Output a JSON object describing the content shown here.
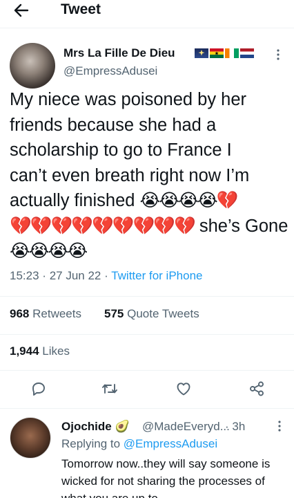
{
  "header": {
    "title": "Tweet",
    "back_icon": "arrow-left-icon"
  },
  "tweet": {
    "author_name": "Mrs La Fille De Dieu",
    "author_handle": "@EmpressAdusei",
    "name_flags": [
      "sparkle-night-flag",
      "ghana-flag",
      "ivory-coast-flag",
      "netherlands-flag"
    ],
    "text_line1": "My niece was poisoned by her",
    "text_line2": "friends because she had a",
    "text_line3": "scholarship to go to France I",
    "text_line4": "can’t even breath right now I’m",
    "text_line5_words": "actually finished",
    "text_line5_emoji": "😭😭😭😭💔",
    "text_line6_emoji": "💔💔💔💔💔💔💔💔💔",
    "text_line6_words": "she’s Gone",
    "text_line7_emoji": "😭😭😭😭",
    "time": "15:23",
    "date": "27 Jun 22",
    "separator": "·",
    "source": "Twitter for iPhone",
    "retweets_count": "968",
    "retweets_label": "Retweets",
    "quotes_count": "575",
    "quotes_label": "Quote Tweets",
    "likes_count": "1,944",
    "likes_label": "Likes"
  },
  "actions": [
    "reply-icon",
    "retweet-icon",
    "like-icon",
    "share-icon"
  ],
  "reply": {
    "author_name": "Ojochide",
    "name_emoji": "🥑",
    "author_handle": "@MadeEveryd...",
    "time": "· 3h",
    "replying_prefix": "Replying to",
    "replying_mention": "@EmpressAdusei",
    "text": "Tomorrow now..they will say someone is wicked for not sharing the processes of what you are up to"
  },
  "colors": {
    "accent": "#1d9bf0",
    "secondary_text": "#536471",
    "divider": "#eff3f4"
  }
}
